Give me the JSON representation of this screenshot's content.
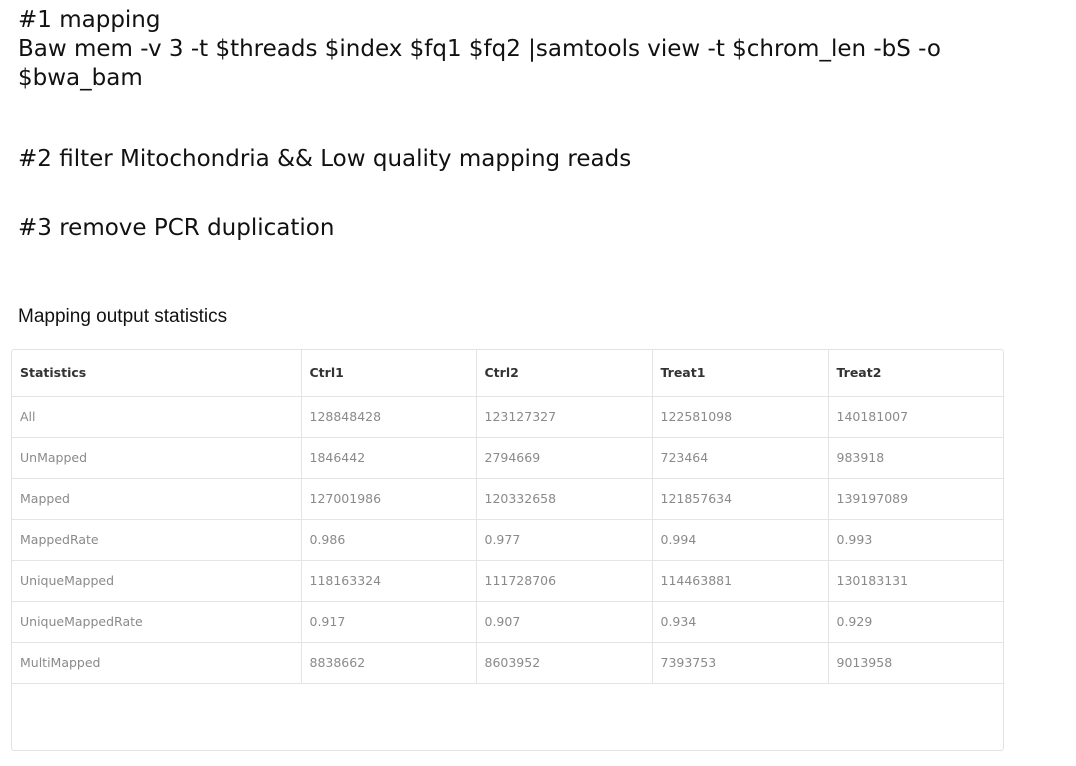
{
  "steps": {
    "step1_line1": "#1 mapping",
    "step1_line2": "Baw mem -v 3 -t $threads $index $fq1 $fq2 |samtools view -t $chrom_len -bS -o",
    "step1_line3": "$bwa_bam",
    "step2": "#2 filter Mitochondria && Low quality mapping reads",
    "step3": "#3 remove PCR duplication"
  },
  "section_title": "Mapping output statistics",
  "table": {
    "headers": [
      "Statistics",
      "Ctrl1",
      "Ctrl2",
      "Treat1",
      "Treat2"
    ],
    "rows": [
      [
        "All",
        "128848428",
        "123127327",
        "122581098",
        "140181007"
      ],
      [
        "UnMapped",
        "1846442",
        "2794669",
        "723464",
        "983918"
      ],
      [
        "Mapped",
        "127001986",
        "120332658",
        "121857634",
        "139197089"
      ],
      [
        "MappedRate",
        "0.986",
        "0.977",
        "0.994",
        "0.993"
      ],
      [
        "UniqueMapped",
        "118163324",
        "111728706",
        "114463881",
        "130183131"
      ],
      [
        "UniqueMappedRate",
        "0.917",
        "0.907",
        "0.934",
        "0.929"
      ],
      [
        "MultiMapped",
        "8838662",
        "8603952",
        "7393753",
        "9013958"
      ]
    ]
  }
}
